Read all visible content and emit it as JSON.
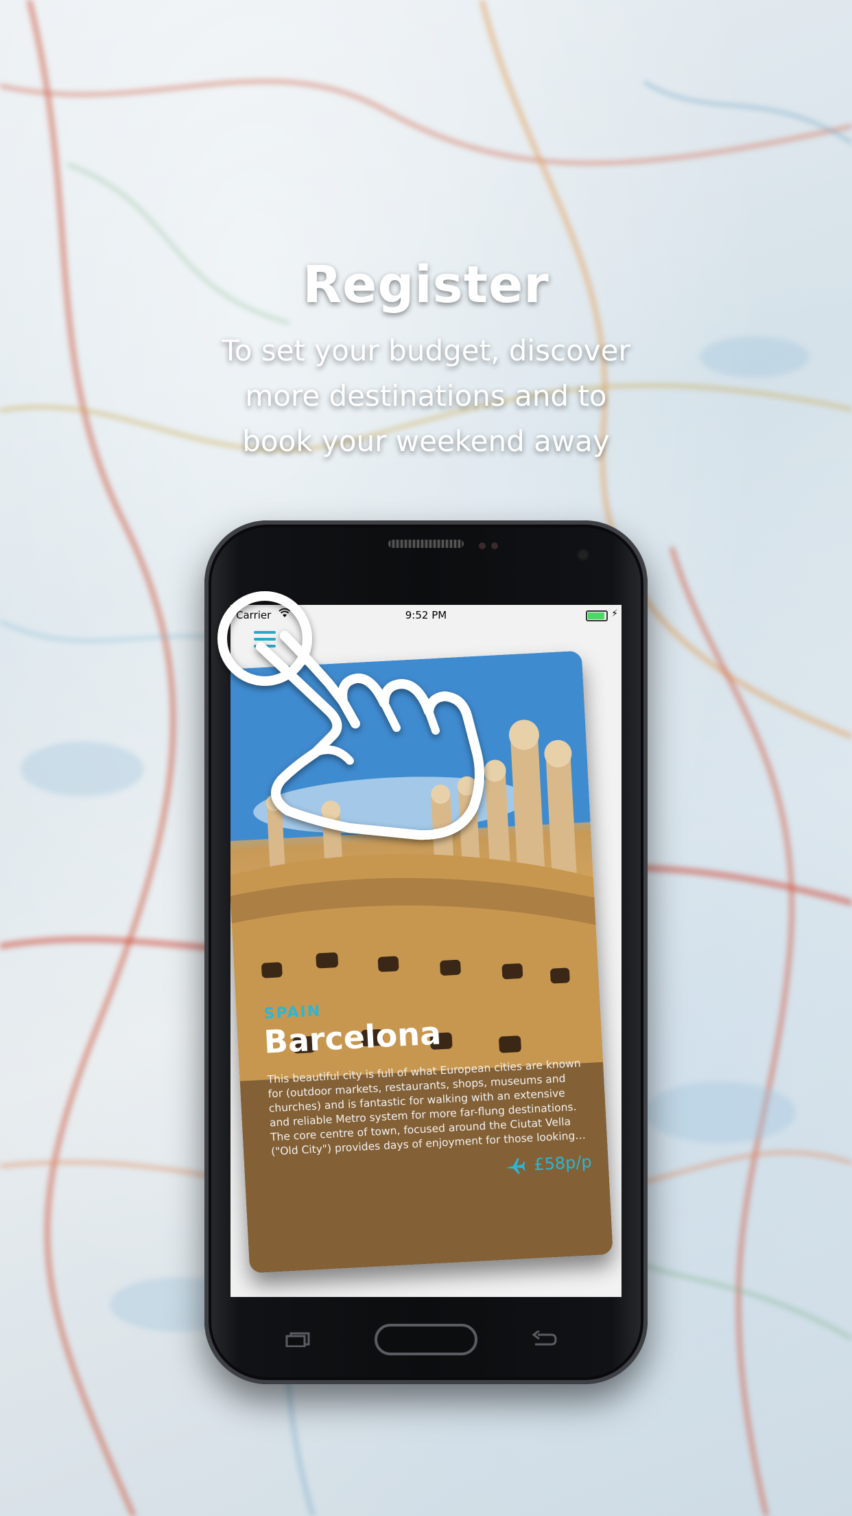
{
  "promo": {
    "title": "Register",
    "subtitle_lines": [
      "To set your budget, discover",
      "more destinations and to",
      "book your weekend away"
    ]
  },
  "status_bar": {
    "carrier": "Carrier",
    "time": "9:52 PM",
    "wifi_icon": "wifi-icon",
    "battery_icon": "battery-charging-icon"
  },
  "app": {
    "menu_icon": "hamburger-menu-icon",
    "card": {
      "country": "SPAIN",
      "city": "Barcelona",
      "description": "This beautiful city is full of what European cities are known for (outdoor markets, restaurants, shops, museums and churches) and is fantastic for walking with an extensive and reliable Metro system for more far-flung destinations. The core centre of town, focused around the Ciutat Vella (\"Old City\") provides days of enjoyment for those looking to experience the life of Barcelona while the beaches the city was built upon provide s...",
      "price": "£58p/p",
      "price_icon": "plane-icon"
    }
  },
  "gesture_icon": "tap-hand-icon",
  "colors": {
    "accent": "#2bb6d6",
    "text_on_image": "#ffffff",
    "phone_body": "#111215"
  }
}
